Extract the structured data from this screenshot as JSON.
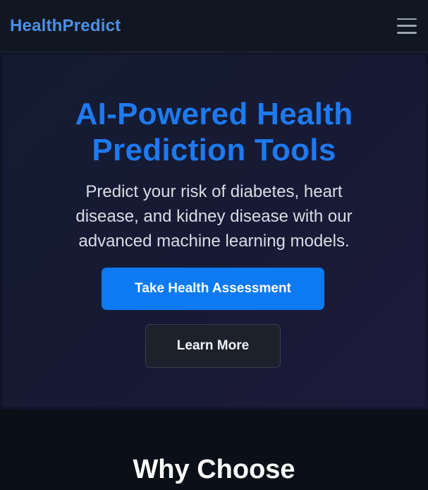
{
  "header": {
    "brand": "HealthPredict",
    "menu_icon": "hamburger-menu-icon"
  },
  "hero": {
    "title_lines": [
      "AI-Powered Health",
      "Prediction Tools"
    ],
    "subtitle_lines": [
      "Predict your risk of diabetes, heart",
      "disease, and kidney disease with our",
      "advanced machine learning models."
    ],
    "primary_cta": "Take Health Assessment",
    "secondary_cta": "Learn More"
  },
  "why_section": {
    "heading": "Why Choose"
  },
  "colors": {
    "brand": "#4c8fe6",
    "title_blue": "#1e7af0",
    "primary_button": "#0d79f2",
    "background": "#0b0f17"
  }
}
